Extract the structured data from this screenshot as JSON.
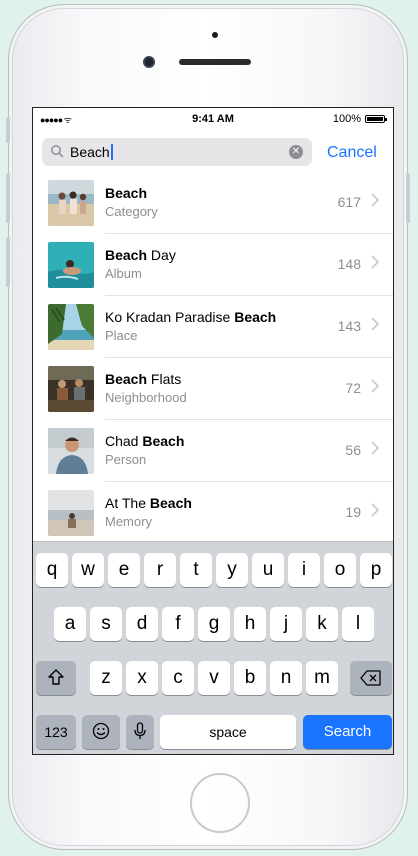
{
  "status": {
    "signal": "●●●●● ᯤ",
    "time": "9:41 AM",
    "battery": "100%",
    "battery_level": 1.0
  },
  "search": {
    "query": "Beach",
    "cancel_label": "Cancel"
  },
  "results": [
    {
      "title_plain": "",
      "title_bold": "Beach",
      "title_after": "",
      "subtitle": "Category",
      "count": "617"
    },
    {
      "title_plain": "",
      "title_bold": "Beach",
      "title_after": " Day",
      "subtitle": "Album",
      "count": "148"
    },
    {
      "title_plain": "Ko Kradan Paradise ",
      "title_bold": "Beach",
      "title_after": "",
      "subtitle": "Place",
      "count": "143"
    },
    {
      "title_plain": "",
      "title_bold": "Beach",
      "title_after": " Flats",
      "subtitle": "Neighborhood",
      "count": "72"
    },
    {
      "title_plain": "Chad ",
      "title_bold": "Beach",
      "title_after": "",
      "subtitle": "Person",
      "count": "56"
    },
    {
      "title_plain": "At The ",
      "title_bold": "Beach",
      "title_after": "",
      "subtitle": "Memory",
      "count": "19"
    }
  ],
  "keyboard": {
    "row1": [
      "q",
      "w",
      "e",
      "r",
      "t",
      "y",
      "u",
      "i",
      "o",
      "p"
    ],
    "row2": [
      "a",
      "s",
      "d",
      "f",
      "g",
      "h",
      "j",
      "k",
      "l"
    ],
    "row3": [
      "z",
      "x",
      "c",
      "v",
      "b",
      "n",
      "m"
    ],
    "numbers_label": "123",
    "space_label": "space",
    "search_label": "Search"
  },
  "colors": {
    "accent": "#1a74ff",
    "secondary_text": "#8e8e93",
    "keyboard_bg": "#d1d4d9"
  }
}
